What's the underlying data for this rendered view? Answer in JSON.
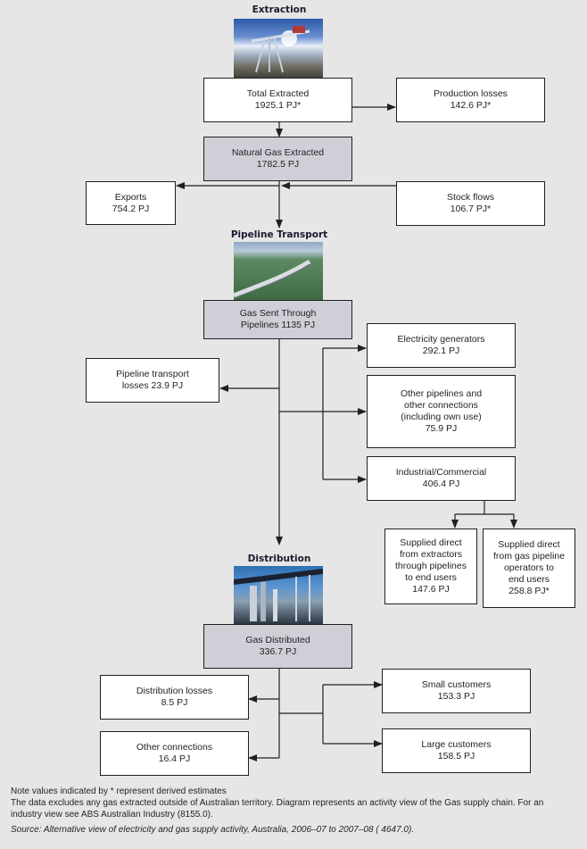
{
  "sections": {
    "extraction": "Extraction",
    "pipeline": "Pipeline Transport",
    "distribution": "Distribution"
  },
  "images": {
    "extraction": "oil-pump-jack-photo",
    "pipeline": "pipeline-landscape-photo",
    "distribution": "industrial-pipes-photo"
  },
  "nodes": {
    "total_extracted": "Total Extracted\n1925.1 PJ*",
    "production_losses": "Production losses\n142.6 PJ*",
    "natural_gas_extracted": "Natural Gas Extracted\n1782.5 PJ",
    "exports": "Exports\n754.2 PJ",
    "stock_flows": "Stock flows\n106.7 PJ*",
    "gas_sent_pipelines": "Gas Sent Through\nPipelines 1135 PJ",
    "pipeline_losses": "Pipeline transport\nlosses 23.9 PJ",
    "electricity_generators": "Electricity generators\n292.1 PJ",
    "other_pipelines": "Other pipelines and\nother connections\n(including own use)\n75.9 PJ",
    "industrial_commercial": "Industrial/Commercial\n406.4  PJ",
    "supplied_extractors": "Supplied direct\nfrom extractors\nthrough pipelines\nto end users\n147.6  PJ",
    "supplied_pipeline_ops": "Supplied direct\nfrom gas pipeline\noperators to\nend users\n258.8  PJ*",
    "gas_distributed": "Gas Distributed\n336.7 PJ",
    "distribution_losses": "Distribution losses\n8.5  PJ",
    "other_connections": "Other connections\n16.4 PJ",
    "small_customers": "Small customers\n153.3  PJ",
    "large_customers": "Large customers\n158.5  PJ"
  },
  "colors": {
    "background": "#e6e6e6",
    "main_box": "#cfcfd8",
    "box": "#ffffff",
    "line": "#231f20"
  },
  "notes": {
    "line1": "Note values indicated by * represent derived estimates",
    "line2": "The data excludes any gas extracted outside of Australian territory. Diagram represents an activity view of the Gas supply chain. For an industry view see ABS Australian Industry (8155.0).",
    "source": "Source: Alternative view of electricity and gas supply activity, Australia, 2006–07 to 2007–08 ( 4647.0)."
  }
}
